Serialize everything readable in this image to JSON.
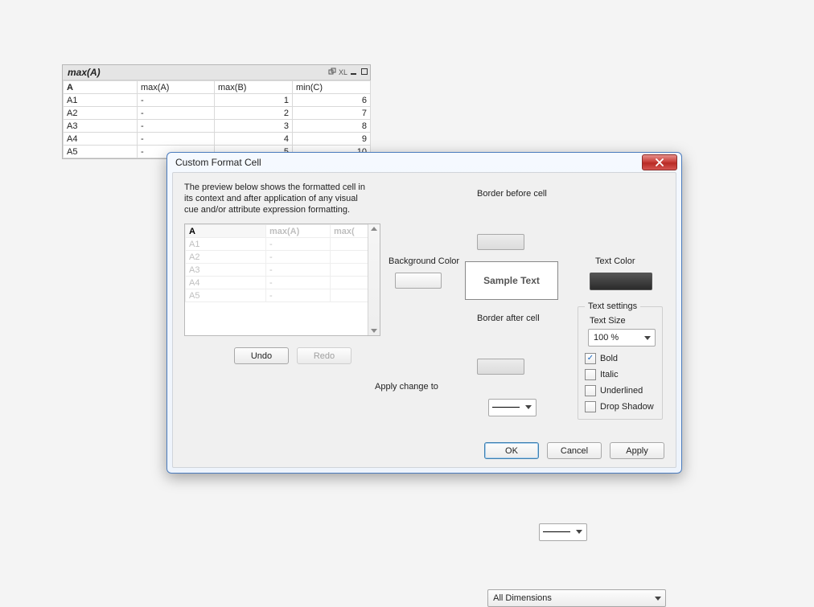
{
  "sheet": {
    "title": "max(A)",
    "columns": [
      "A",
      "max(A)",
      "max(B)",
      "min(C)"
    ],
    "rows": [
      {
        "a": "A1",
        "maxA": "-",
        "maxB": "1",
        "minC": "6"
      },
      {
        "a": "A2",
        "maxA": "-",
        "maxB": "2",
        "minC": "7"
      },
      {
        "a": "A3",
        "maxA": "-",
        "maxB": "3",
        "minC": "8"
      },
      {
        "a": "A4",
        "maxA": "-",
        "maxB": "4",
        "minC": "9"
      },
      {
        "a": "A5",
        "maxA": "-",
        "maxB": "5",
        "minC": "10"
      }
    ],
    "icons": {
      "detach": "detach-icon",
      "xl": "XL",
      "minimize": "minimize-icon",
      "maximize": "maximize-icon"
    }
  },
  "dialog": {
    "title": "Custom Format Cell",
    "description": "The preview below shows the formatted cell in its context and after application of any visual cue and/or attribute expression formatting.",
    "preview": {
      "columns": [
        "A",
        "max(A)",
        "max("
      ],
      "rows": [
        {
          "a": "A1",
          "v1": "-",
          "v2": ""
        },
        {
          "a": "A2",
          "v1": "-",
          "v2": ""
        },
        {
          "a": "A3",
          "v1": "-",
          "v2": ""
        },
        {
          "a": "A4",
          "v1": "-",
          "v2": ""
        },
        {
          "a": "A5",
          "v1": "-",
          "v2": ""
        }
      ]
    },
    "undo_label": "Undo",
    "redo_label": "Redo",
    "background_color_label": "Background Color",
    "border_before_label": "Border before cell",
    "border_after_label": "Border after cell",
    "sample_text": "Sample Text",
    "text_color_label": "Text Color",
    "apply_change_label": "Apply change to",
    "apply_change_value": "All Dimensions",
    "text_settings_legend": "Text settings",
    "text_size_label": "Text Size",
    "text_size_value": "100 %",
    "bold_label": "Bold",
    "italic_label": "Italic",
    "underlined_label": "Underlined",
    "dropshadow_label": "Drop Shadow",
    "bold_checked": true,
    "italic_checked": false,
    "underlined_checked": false,
    "dropshadow_checked": false,
    "ok_label": "OK",
    "cancel_label": "Cancel",
    "apply_label": "Apply"
  }
}
